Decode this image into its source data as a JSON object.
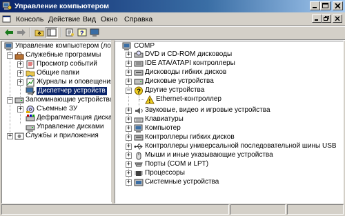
{
  "window": {
    "title": "Управление компьютером"
  },
  "menu": {
    "items": [
      "Консоль",
      "Действие",
      "Вид",
      "Окно",
      "Справка"
    ]
  },
  "left_tree": {
    "root": "Управление компьютером (локаль",
    "system_tools": "Служебные программы",
    "event_viewer": "Просмотр событий",
    "shared_folders": "Общие папки",
    "logs": "Журналы и оповещения пр",
    "device_manager": "Диспетчер устройств",
    "storage": "Запоминающие устройства",
    "removable": "Съемные ЗУ",
    "defrag": "Дефрагментация диска",
    "disk_mgmt": "Управление дисками",
    "services": "Службы и приложения"
  },
  "right_tree": {
    "root": "COMP",
    "items": [
      "DVD и CD-ROM дисководы",
      "IDE ATA/ATAPI контроллеры",
      "Дисководы гибких дисков",
      "Дисковые устройства",
      "Другие устройства",
      "Ethernet-контроллер",
      "Звуковые, видео и игровые устройства",
      "Клавиатуры",
      "Компьютер",
      "Контроллеры гибких дисков",
      "Контроллеры универсальной последовательной шины USB",
      "Мыши и иные указывающие устройства",
      "Порты (COM и LPT)",
      "Процессоры",
      "Системные устройства"
    ]
  },
  "colors": {
    "title_active": "#0a246a",
    "selection": "#0a246a",
    "face": "#d4d0c8"
  }
}
